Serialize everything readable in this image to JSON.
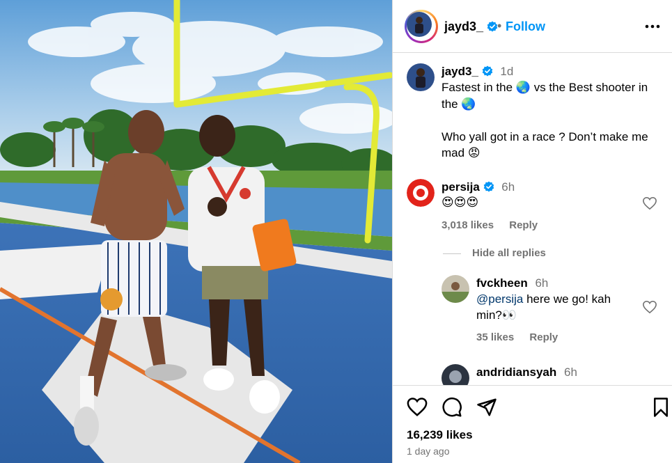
{
  "post": {
    "author": "jayd3_",
    "follow_label": "Follow",
    "dot": "•",
    "likes": "16,239 likes",
    "age": "1 day ago"
  },
  "caption": {
    "username": "jayd3_",
    "time": "1d",
    "line1_a": "Fastest in the",
    "line1_b": "vs the Best shooter in",
    "line2": "the",
    "line3": "Who yall got in a race ? Don’t make me",
    "line4": "mad",
    "globe_emoji": "🌏",
    "angry_emoji": "😡"
  },
  "comments": [
    {
      "username": "persija",
      "verified": true,
      "time": "6h",
      "text": "😍😍😍",
      "likes": "3,018 likes",
      "reply_label": "Reply"
    }
  ],
  "replies": {
    "toggle_label": "Hide all replies",
    "items": [
      {
        "username": "fvckheen",
        "time": "6h",
        "mention": "@persija",
        "text_a": "here we go! kah",
        "text_b": "min?",
        "emoji": "👀",
        "likes": "35 likes",
        "reply_label": "Reply"
      },
      {
        "username": "andridiansyah",
        "time": "6h"
      }
    ]
  },
  "colors": {
    "accent": "#0095f6",
    "verified": "#0095f6",
    "muted": "#737373",
    "mention": "#00376b"
  },
  "icons": {
    "more": "more-horizontal-icon",
    "like": "heart-icon",
    "comment": "comment-icon",
    "share": "send-icon",
    "save": "bookmark-icon"
  }
}
